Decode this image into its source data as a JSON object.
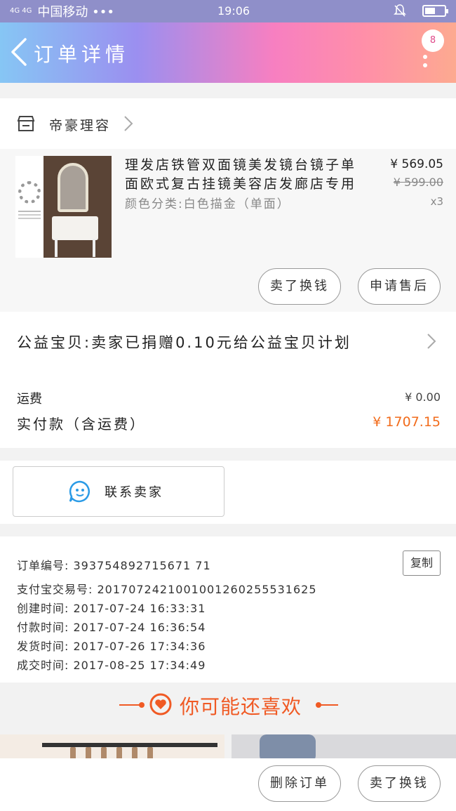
{
  "status_bar": {
    "signal": "4G 4G",
    "carrier": "中国移动 •••",
    "time": "19:06"
  },
  "header": {
    "title": "订单详情",
    "badge": "8"
  },
  "store": {
    "name": "帝豪理容"
  },
  "product": {
    "title": "理发店铁管双面镜美发镜台镜子单面欧式复古挂镜美容店发廊店专用",
    "spec": "颜色分类:白色描金（单面）",
    "price": "¥ 569.05",
    "original_price": "¥ 599.00",
    "quantity": "x3",
    "btn_sell_again": "卖了换钱",
    "btn_after_sale": "申请售后"
  },
  "charity": {
    "text": "公益宝贝:卖家已捐赠0.10元给公益宝贝计划"
  },
  "fees": {
    "shipping_label": "运费",
    "shipping_value": "¥ 0.00",
    "paid_label": "实付款（含运费）",
    "paid_value": "¥ 1707.15"
  },
  "contact": {
    "label": "联系卖家"
  },
  "order_info": {
    "order_no": "订单编号: 393754892715671 71",
    "alipay_no": "支付宝交易号: 2017072421001001260255531625",
    "created": "创建时间: 2017-07-24 16:33:31",
    "paid": "付款时间: 2017-07-24 16:36:54",
    "shipped": "发货时间: 2017-07-26 17:34:36",
    "completed": "成交时间: 2017-08-25 17:34:49",
    "copy_label": "复制"
  },
  "recommend": {
    "title": "你可能还喜欢"
  },
  "bottom_bar": {
    "delete_label": "删除订单",
    "sell_label": "卖了换钱"
  },
  "colors": {
    "accent": "#f05a24",
    "price_paid": "#f26c1c"
  }
}
